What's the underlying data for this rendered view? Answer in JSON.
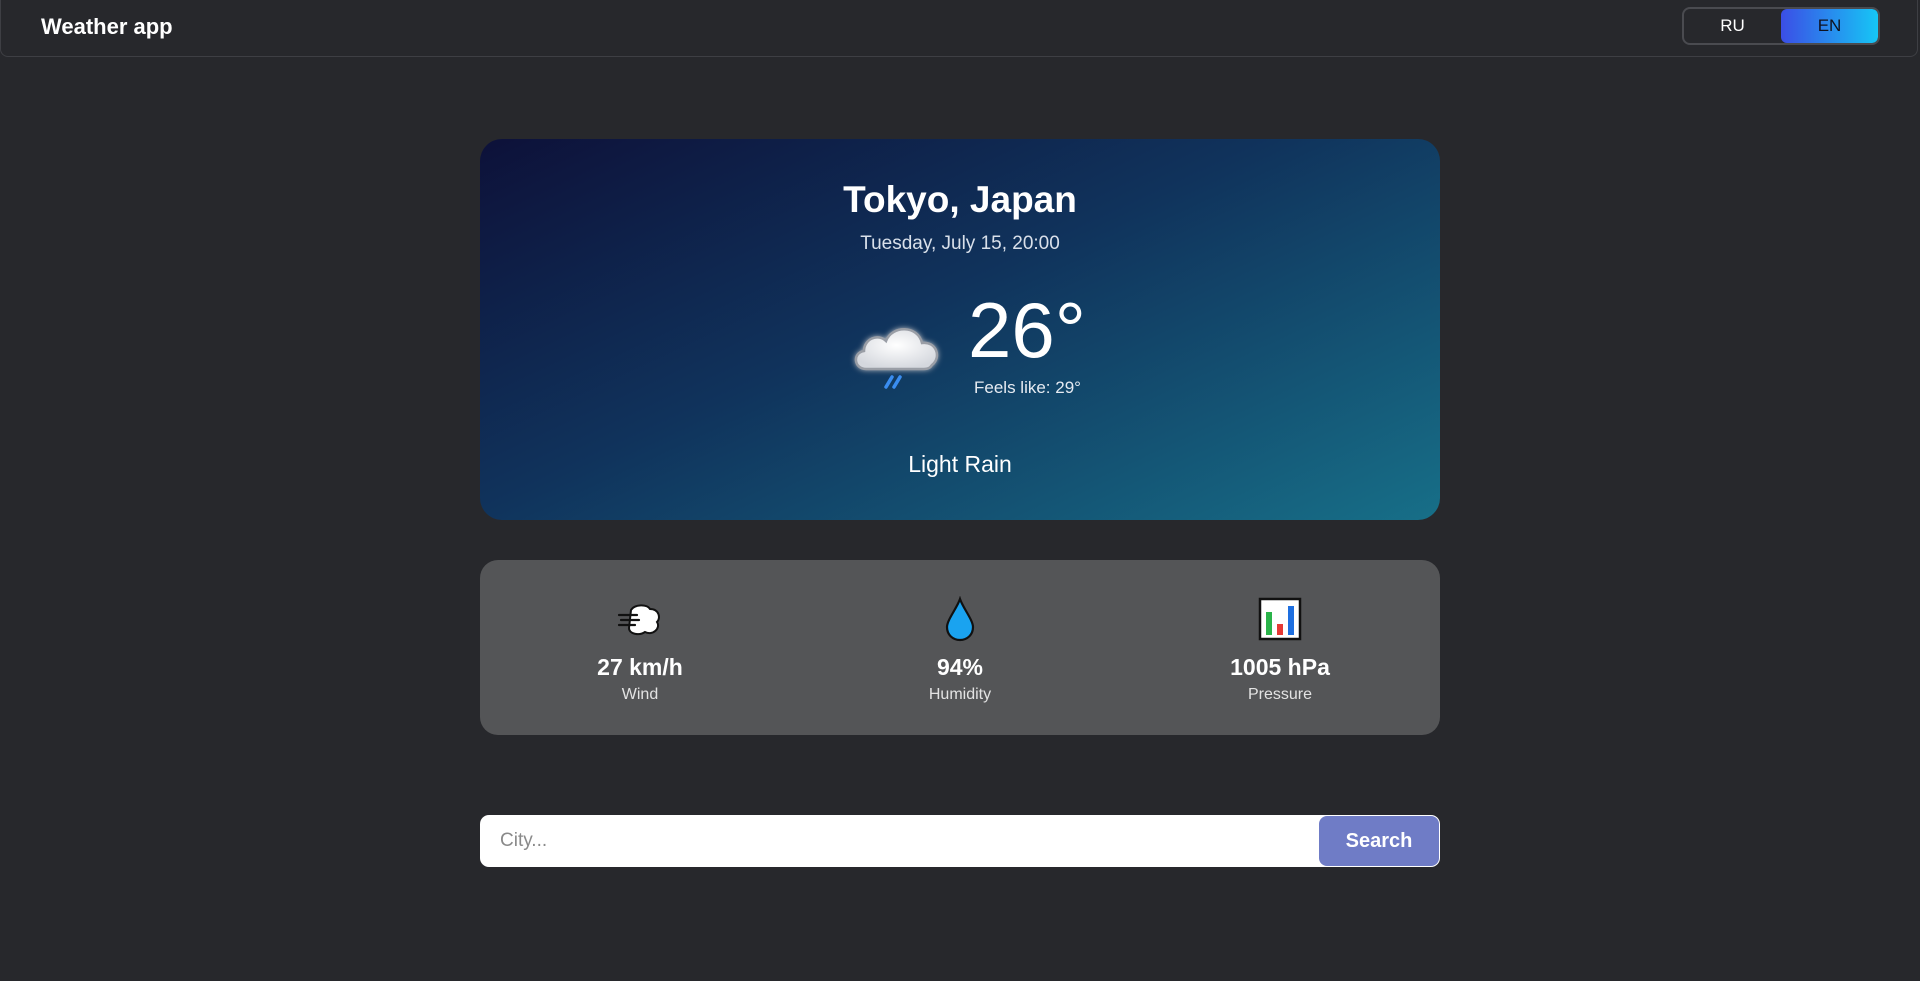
{
  "header": {
    "title": "Weather app",
    "languages": [
      {
        "label": "RU",
        "active": false
      },
      {
        "label": "EN",
        "active": true
      }
    ]
  },
  "weather": {
    "city": "Tokyo, Japan",
    "datetime": "Tuesday, July 15, 20:00",
    "icon": "cloud-rain-icon",
    "temperature": "26°",
    "feels_like": "Feels like: 29°",
    "condition": "Light Rain"
  },
  "stats": [
    {
      "icon": "wind-icon",
      "value": "27 km/h",
      "label": "Wind"
    },
    {
      "icon": "droplet-icon",
      "value": "94%",
      "label": "Humidity"
    },
    {
      "icon": "bar-chart-icon",
      "value": "1005 hPa",
      "label": "Pressure"
    }
  ],
  "search": {
    "placeholder": "City...",
    "value": "",
    "button_label": "Search"
  },
  "colors": {
    "background": "#27282c",
    "accent_start": "#3b4ee6",
    "accent_end": "#16c6f5",
    "search_button": "#6f7cc6",
    "stats_card": "#545557"
  }
}
